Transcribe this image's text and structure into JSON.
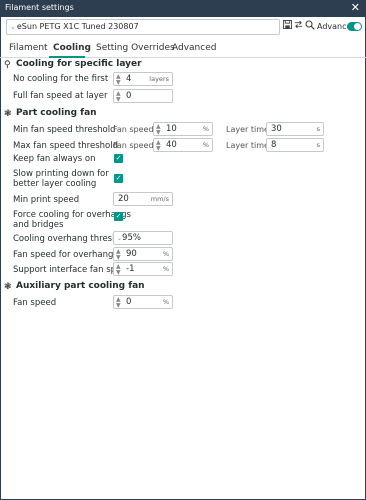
{
  "window": {
    "title": "Filament settings",
    "close": "✕"
  },
  "toolbar": {
    "preset_value": "eSun PETG X1C Tuned 230807",
    "save_icon": "save-icon",
    "compare_icon": "compare-icon",
    "search_icon": "search-icon",
    "advanced_label": "Advanced",
    "advanced_on": true
  },
  "tabs": [
    "Filament",
    "Cooling",
    "Setting Overrides",
    "Advanced"
  ],
  "active_tab": "Cooling",
  "accent_color": "#009688",
  "specific_layer": {
    "title": "Cooling for specific layer",
    "no_cooling_label": "No cooling for the first",
    "no_cooling_value": "4",
    "no_cooling_unit": "layers",
    "full_fan_label": "Full fan speed at layer",
    "full_fan_value": "0"
  },
  "part_fan": {
    "title": "Part cooling fan",
    "min_label": "Min fan speed threshold",
    "max_label": "Max fan speed threshold",
    "fan_speed_label": "Fan speed",
    "layer_time_label": "Layer time",
    "min_fan_value": "10",
    "min_layer_time": "30",
    "max_fan_value": "40",
    "max_layer_time": "8",
    "percent": "%",
    "seconds": "s",
    "keep_fan_label": "Keep fan always on",
    "slow_label_1": "Slow printing down for",
    "slow_label_2": "better layer cooling",
    "min_print_speed_label": "Min print speed",
    "min_print_speed_value": "20",
    "min_print_speed_unit": "mm/s",
    "force_label_1": "Force cooling for overhangs",
    "force_label_2": "and bridges",
    "overhang_threshold_label": "Cooling overhang threshold",
    "overhang_threshold_value": "95%",
    "overhang_fan_label": "Fan speed for overhangs",
    "overhang_fan_value": "90",
    "support_fan_label": "Support interface fan speed",
    "support_fan_value": "-1"
  },
  "aux_fan": {
    "title": "Auxiliary part cooling fan",
    "fan_speed_label": "Fan speed",
    "fan_speed_value": "0"
  }
}
